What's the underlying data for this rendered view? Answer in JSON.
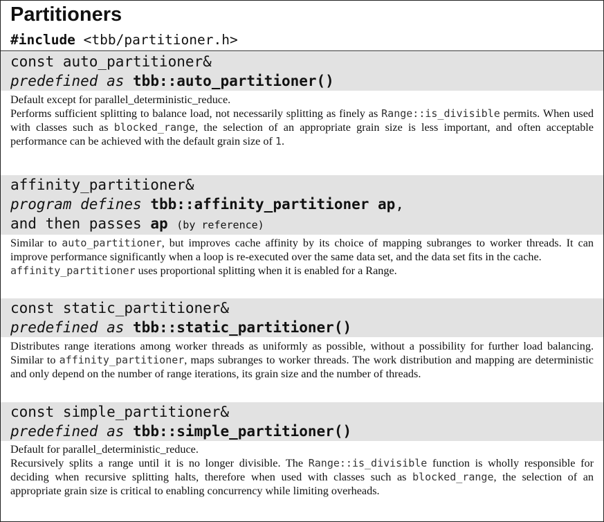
{
  "title": "Partitioners",
  "include": {
    "keyword": "#include",
    "header": "<tbb/partitioner.h>"
  },
  "sections": [
    {
      "head_line1": "const auto_partitioner&",
      "head_line2_prefix": "predefined as",
      "head_line2_bold": "tbb::auto_partitioner()",
      "p1": "Default except for parallel_deterministic_reduce.",
      "p2_a": "Performs sufficient splitting to balance load, not necessarily splitting as finely as",
      "p2_code1": "Range::is_divisible",
      "p2_b": "permits. When used with classes such as",
      "p2_code2": "blocked_range",
      "p2_c": ", the selection of an appropriate grain size is less important, and often acceptable performance can be achieved with the default grain size of",
      "p2_code3": "1",
      "p2_d": "."
    },
    {
      "head_line1": "affinity_partitioner&",
      "head_line2_prefix": "program defines",
      "head_line2_bold": "tbb::affinity_partitioner ap",
      "head_line2_suffix": ",",
      "head_line3_prefix": "and then passes",
      "head_line3_bold": "ap",
      "head_line3_small": "(by reference)",
      "p1_a": "Similar to",
      "p1_code": "auto_partitioner",
      "p1_b": ", but improves cache affinity by its choice of mapping subranges to worker threads. It can improve performance significantly when a loop is re-executed over the same data set, and the data set fits in the cache.",
      "p2_code": "affinity_partitioner",
      "p2_b": "uses proportional splitting when it is enabled for a Range."
    },
    {
      "head_line1": "const static_partitioner&",
      "head_line2_prefix": "predefined as",
      "head_line2_bold": "tbb::static_partitioner()",
      "p1_a": "Distributes range iterations among worker threads as uniformly as possible, without a possibility for further load balancing. Similar to",
      "p1_code": "affinity_partitioner",
      "p1_b": ", maps subranges to worker threads. The work distribution and mapping are deterministic and only depend on the number of range iterations, its grain size and the number of threads."
    },
    {
      "head_line1": "const simple_partitioner&",
      "head_line2_prefix": "predefined as",
      "head_line2_bold": "tbb::simple_partitioner()",
      "p1": "Default for parallel_deterministic_reduce.",
      "p2_a": "Recursively splits a range until it is no longer divisible. The",
      "p2_code1": "Range::is_divisible",
      "p2_b": "function is wholly responsible for deciding when recursive splitting halts, therefore when used with classes such as",
      "p2_code2": "blocked_range",
      "p2_c": ", the selection of an appropriate grain size is critical to enabling concurrency while limiting overheads."
    }
  ]
}
